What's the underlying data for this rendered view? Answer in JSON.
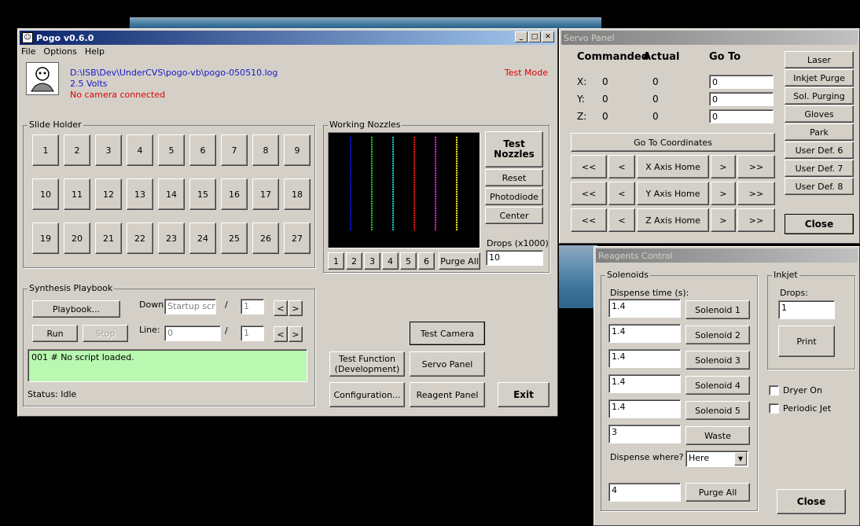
{
  "pogo": {
    "title": "Pogo v0.6.0",
    "menu": [
      "File",
      "Options",
      "Help"
    ],
    "log_path": "D:\\ISB\\Dev\\UnderCVS\\pogo-vb\\pogo-050510.log",
    "voltage": "2.5 Volts",
    "camera_status": "No camera connected",
    "mode": "Test Mode",
    "slide_holder": {
      "label": "Slide Holder",
      "slides": [
        "1",
        "2",
        "3",
        "4",
        "5",
        "6",
        "7",
        "8",
        "9",
        "10",
        "11",
        "12",
        "13",
        "14",
        "15",
        "16",
        "17",
        "18",
        "19",
        "20",
        "21",
        "22",
        "23",
        "24",
        "25",
        "26",
        "27"
      ]
    },
    "nozzles": {
      "label": "Working Nozzles",
      "colors": [
        "#1010d0",
        "#20c020",
        "#20c0c0",
        "#e01010",
        "#d020d0",
        "#e0e020"
      ],
      "buttons": [
        "1",
        "2",
        "3",
        "4",
        "5",
        "6"
      ],
      "purge_all": "Purge All",
      "test_nozzles": "Test Nozzles",
      "reset": "Reset",
      "photodiode": "Photodiode",
      "center": "Center",
      "drops_label": "Drops (x1000)",
      "drops_value": "10"
    },
    "playbook": {
      "label": "Synthesis Playbook",
      "playbook_btn": "Playbook...",
      "down_label": "Down:",
      "down_value": "Startup script",
      "down_count": "1",
      "run": "Run",
      "stop": "Stop",
      "line_label": "Line:",
      "line_value": "0",
      "line_count": "1",
      "slash": "/",
      "prev": "<",
      "next": ">",
      "script_text": "001  # No script loaded.",
      "status": "Status:  Idle"
    },
    "bottom_buttons": {
      "test_camera": "Test Camera",
      "test_function": "Test Function (Development)",
      "servo_panel": "Servo Panel",
      "configuration": "Configuration...",
      "reagent_panel": "Reagent Panel",
      "exit": "Exit"
    }
  },
  "servo": {
    "title": "Servo Panel",
    "headers": {
      "commanded": "Commanded",
      "actual": "Actual",
      "goto": "Go To"
    },
    "axes": [
      {
        "axis": "X:",
        "commanded": "0",
        "actual": "0",
        "goto": "0"
      },
      {
        "axis": "Y:",
        "commanded": "0",
        "actual": "0",
        "goto": "0"
      },
      {
        "axis": "Z:",
        "commanded": "0",
        "actual": "0",
        "goto": "0"
      }
    ],
    "go_to_coords": "Go To Coordinates",
    "home_rows": [
      {
        "ll": "<<",
        "l": "<",
        "home": "X Axis Home",
        "r": ">",
        "rr": ">>"
      },
      {
        "ll": "<<",
        "l": "<",
        "home": "Y Axis Home",
        "r": ">",
        "rr": ">>"
      },
      {
        "ll": "<<",
        "l": "<",
        "home": "Z Axis Home",
        "r": ">",
        "rr": ">>"
      }
    ],
    "side_buttons": [
      "Laser",
      "Inkjet Purge",
      "Sol. Purging",
      "Gloves",
      "Park",
      "User Def. 6",
      "User Def. 7",
      "User Def. 8"
    ],
    "close": "Close"
  },
  "reagents": {
    "title": "Reagents Control",
    "solenoids_label": "Solenoids",
    "dispense_label": "Dispense time (s):",
    "rows": [
      {
        "value": "1.4",
        "button": "Solenoid 1"
      },
      {
        "value": "1.4",
        "button": "Solenoid 2"
      },
      {
        "value": "1.4",
        "button": "Solenoid 3"
      },
      {
        "value": "1.4",
        "button": "Solenoid 4"
      },
      {
        "value": "1.4",
        "button": "Solenoid 5"
      },
      {
        "value": "3",
        "button": "Waste"
      }
    ],
    "dispense_where_label": "Dispense where?",
    "dispense_where_value": "Here",
    "purge_value": "4",
    "purge_all": "Purge All",
    "inkjet_label": "Inkjet",
    "drops_label": "Drops:",
    "drops_value": "1",
    "print": "Print",
    "dryer_on": "Dryer On",
    "periodic_jet": "Periodic Jet",
    "close": "Close"
  }
}
